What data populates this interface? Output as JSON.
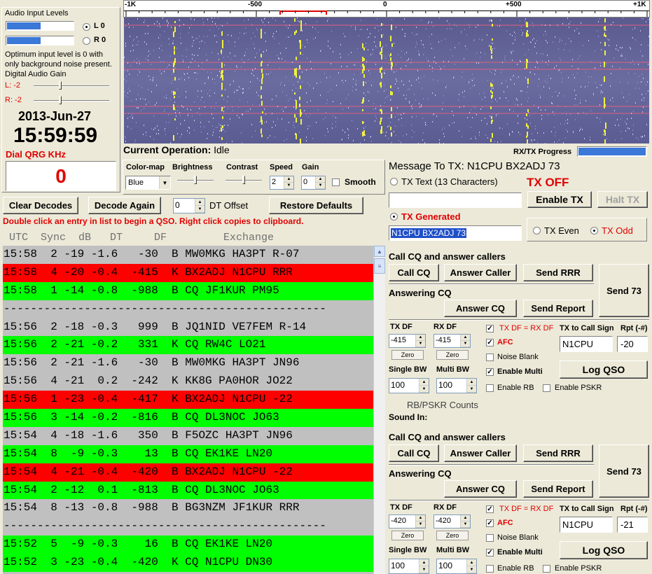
{
  "audio": {
    "title": "Audio Input Levels",
    "l_label": "L 0",
    "r_label": "R 0",
    "left_level": 0.52,
    "right_level": 0.52,
    "note": "Optimum input level is 0 with only background noise present.",
    "gain_title": "Digital Audio Gain",
    "gain_l": "L: -2",
    "gain_r": "R: -2"
  },
  "clock": {
    "date": "2013-Jun-27",
    "time": "15:59:59"
  },
  "dial": {
    "label": "Dial QRG KHz",
    "value": "0"
  },
  "waterfall": {
    "scale": [
      "-1K",
      "-500",
      "0",
      "+500",
      "+1K"
    ],
    "progress_label": "RX/TX Progress"
  },
  "current_op": {
    "label": "Current Operation:",
    "value": "Idle"
  },
  "controls": {
    "colormap_label": "Color-map",
    "colormap_value": "Blue",
    "brightness_label": "Brightness",
    "contrast_label": "Contrast",
    "speed_label": "Speed",
    "speed_value": "2",
    "gain_label": "Gain",
    "gain_value": "0",
    "smooth_label": "Smooth"
  },
  "toolbar": {
    "clear_decodes": "Clear Decodes",
    "decode_again": "Decode Again",
    "dt_offset_value": "0",
    "dt_offset_label": "DT Offset",
    "restore_defaults": "Restore Defaults"
  },
  "hint": "Double click an entry in list to begin a QSO.  Right click copies to clipboard.",
  "list_header": " UTC  Sync  dB   DT     DF         Exchange",
  "decodes": [
    {
      "text": "15:58  2 -19 -1.6   -30  B MW0MKG HA3PT R-07",
      "color": "gray"
    },
    {
      "text": "15:58  4 -20 -0.4  -415  K BX2ADJ N1CPU RRR",
      "color": "red"
    },
    {
      "text": "15:58  1 -14 -0.8  -988  B CQ JF1KUR PM95",
      "color": "green"
    },
    {
      "text": "------------------------------------------------",
      "color": "gray"
    },
    {
      "text": "15:56  2 -18 -0.3   999  B JQ1NID VE7FEM R-14",
      "color": "gray"
    },
    {
      "text": "15:56  2 -21 -0.2   331  K CQ RW4C LO21",
      "color": "green"
    },
    {
      "text": "15:56  2 -21 -1.6   -30  B MW0MKG HA3PT JN96",
      "color": "gray"
    },
    {
      "text": "15:56  4 -21  0.2  -242  K KK8G PA0HOR JO22",
      "color": "gray"
    },
    {
      "text": "15:56  1 -23 -0.4  -417  K BX2ADJ N1CPU -22",
      "color": "red"
    },
    {
      "text": "15:56  3 -14 -0.2  -816  B CQ DL3NOC JO63",
      "color": "green"
    },
    {
      "text": "15:54  4 -18 -1.6   350  B F5OZC HA3PT JN96",
      "color": "gray"
    },
    {
      "text": "15:54  8  -9 -0.3    13  B CQ EK1KE LN20",
      "color": "green"
    },
    {
      "text": "15:54  4 -21 -0.4  -420  B BX2ADJ N1CPU -22",
      "color": "red"
    },
    {
      "text": "15:54  2 -12  0.1  -813  B CQ DL3NOC JO63",
      "color": "green"
    },
    {
      "text": "15:54  8 -13 -0.8  -988  B BG3NZM JF1KUR RRR",
      "color": "gray"
    },
    {
      "text": "------------------------------------------------",
      "color": "gray"
    },
    {
      "text": "15:52  5  -9 -0.3    16  B CQ EK1KE LN20",
      "color": "green"
    },
    {
      "text": "15:52  3 -23 -0.4  -420  K CQ N1CPU DN30",
      "color": "green"
    }
  ],
  "tx": {
    "message_label": "Message To TX:",
    "message_value": "N1CPU BX2ADJ 73",
    "tx_text_label": "TX Text (13 Characters)",
    "tx_off": "TX OFF",
    "enable_tx": "Enable TX",
    "halt_tx": "Halt TX",
    "tx_generated_label": "TX Generated",
    "tx_generated_value": "N1CPU BX2ADJ 73",
    "tx_even": "TX Even",
    "tx_odd": "TX Odd"
  },
  "qso_panels": [
    {
      "cq_title": "Call CQ and answer callers",
      "call_cq": "Call CQ",
      "answer_caller": "Answer Caller",
      "send_rrr": "Send RRR",
      "send_73": "Send 73",
      "answering_title": "Answering CQ",
      "answer_cq": "Answer CQ",
      "send_report": "Send Report",
      "tx_df_label": "TX DF",
      "tx_df_value": "-415",
      "rx_df_label": "RX DF",
      "rx_df_value": "-415",
      "zero": "Zero",
      "txdf_eq_rxdf": "TX DF = RX DF",
      "afc": "AFC",
      "noise_blank": "Noise Blank",
      "enable_multi": "Enable Multi",
      "tx_to_call_label": "TX to Call Sign",
      "tx_to_call_value": "N1CPU",
      "rpt_label": "Rpt (-#)",
      "rpt_value": "-20",
      "log_qso": "Log QSO",
      "single_bw_label": "Single BW",
      "single_bw_value": "100",
      "multi_bw_label": "Multi BW",
      "multi_bw_value": "100",
      "enable_rb": "Enable RB",
      "enable_pskr": "Enable PSKR"
    },
    {
      "cq_title": "Call CQ and answer callers",
      "call_cq": "Call CQ",
      "answer_caller": "Answer Caller",
      "send_rrr": "Send RRR",
      "send_73": "Send 73",
      "answering_title": "Answering CQ",
      "answer_cq": "Answer CQ",
      "send_report": "Send Report",
      "tx_df_label": "TX DF",
      "tx_df_value": "-420",
      "rx_df_label": "RX DF",
      "rx_df_value": "-420",
      "zero": "Zero",
      "txdf_eq_rxdf": "TX DF = RX DF",
      "afc": "AFC",
      "noise_blank": "Noise Blank",
      "enable_multi": "Enable Multi",
      "tx_to_call_label": "TX to Call Sign",
      "tx_to_call_value": "N1CPU",
      "rpt_label": "Rpt (-#)",
      "rpt_value": "-21",
      "log_qso": "Log QSO",
      "single_bw_label": "Single BW",
      "single_bw_value": "100",
      "multi_bw_label": "Multi BW",
      "multi_bw_value": "100",
      "enable_rb": "Enable RB",
      "enable_pskr": "Enable PSKR"
    }
  ],
  "counts": {
    "rb_pskr": "RB/PSKR Counts",
    "sound_in": "Sound In:"
  }
}
